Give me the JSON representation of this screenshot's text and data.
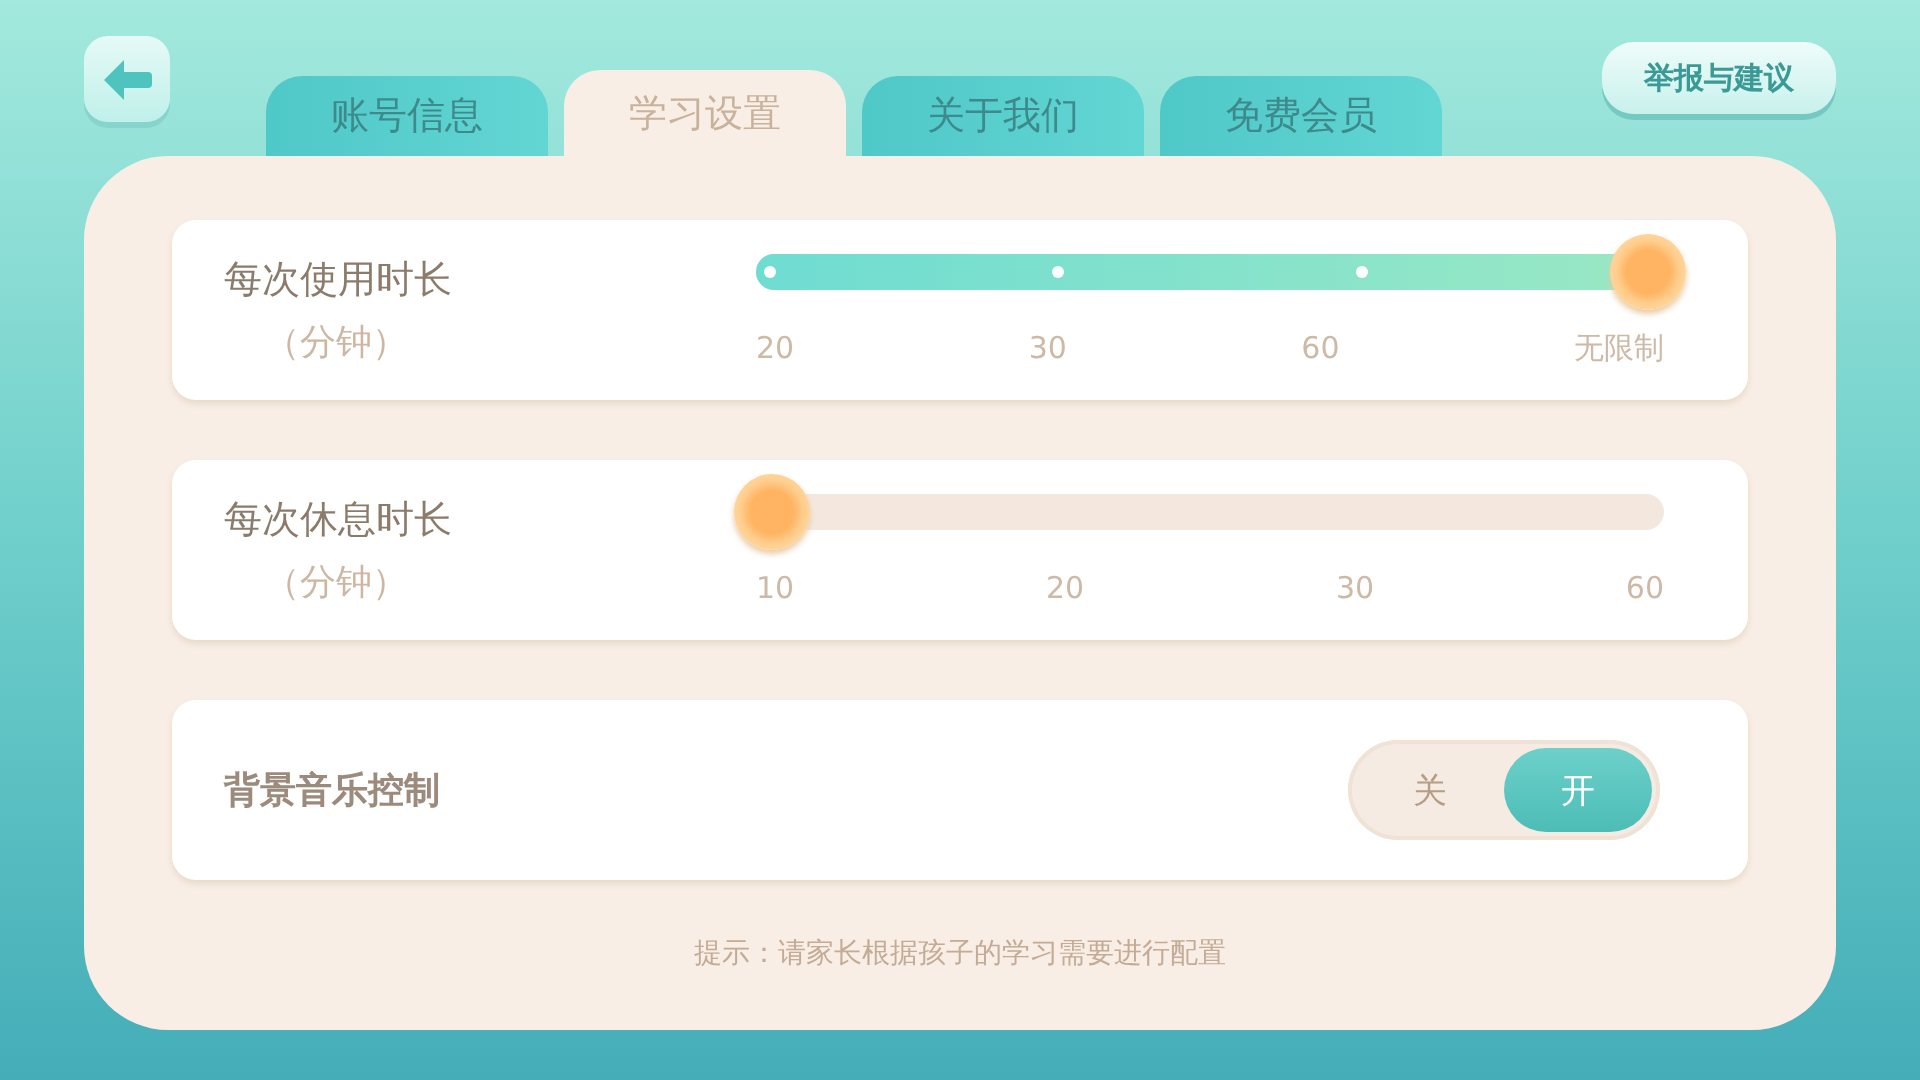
{
  "report_button": "举报与建议",
  "tabs": [
    {
      "label": "账号信息",
      "selected": false
    },
    {
      "label": "学习设置",
      "selected": true
    },
    {
      "label": "关于我们",
      "selected": false
    },
    {
      "label": "免费会员",
      "selected": false
    }
  ],
  "settings": [
    {
      "kind": "slider",
      "label": "每次使用时长",
      "unit": "（分钟）",
      "level": 1,
      "ticks": [
        "20",
        "30",
        "60",
        "无限制"
      ]
    },
    {
      "kind": "slider",
      "label": "每次休息时长",
      "unit": "（分钟）",
      "level": 0,
      "ticks": [
        "10",
        "20",
        "30",
        "60"
      ]
    },
    {
      "kind": "toggle",
      "label": "背景音乐控制",
      "options": [
        {
          "label": "关",
          "selected": false
        },
        {
          "label": "开",
          "selected": true
        }
      ]
    }
  ],
  "hint": "提示：请家长根据孩子的学习需要进行配置"
}
